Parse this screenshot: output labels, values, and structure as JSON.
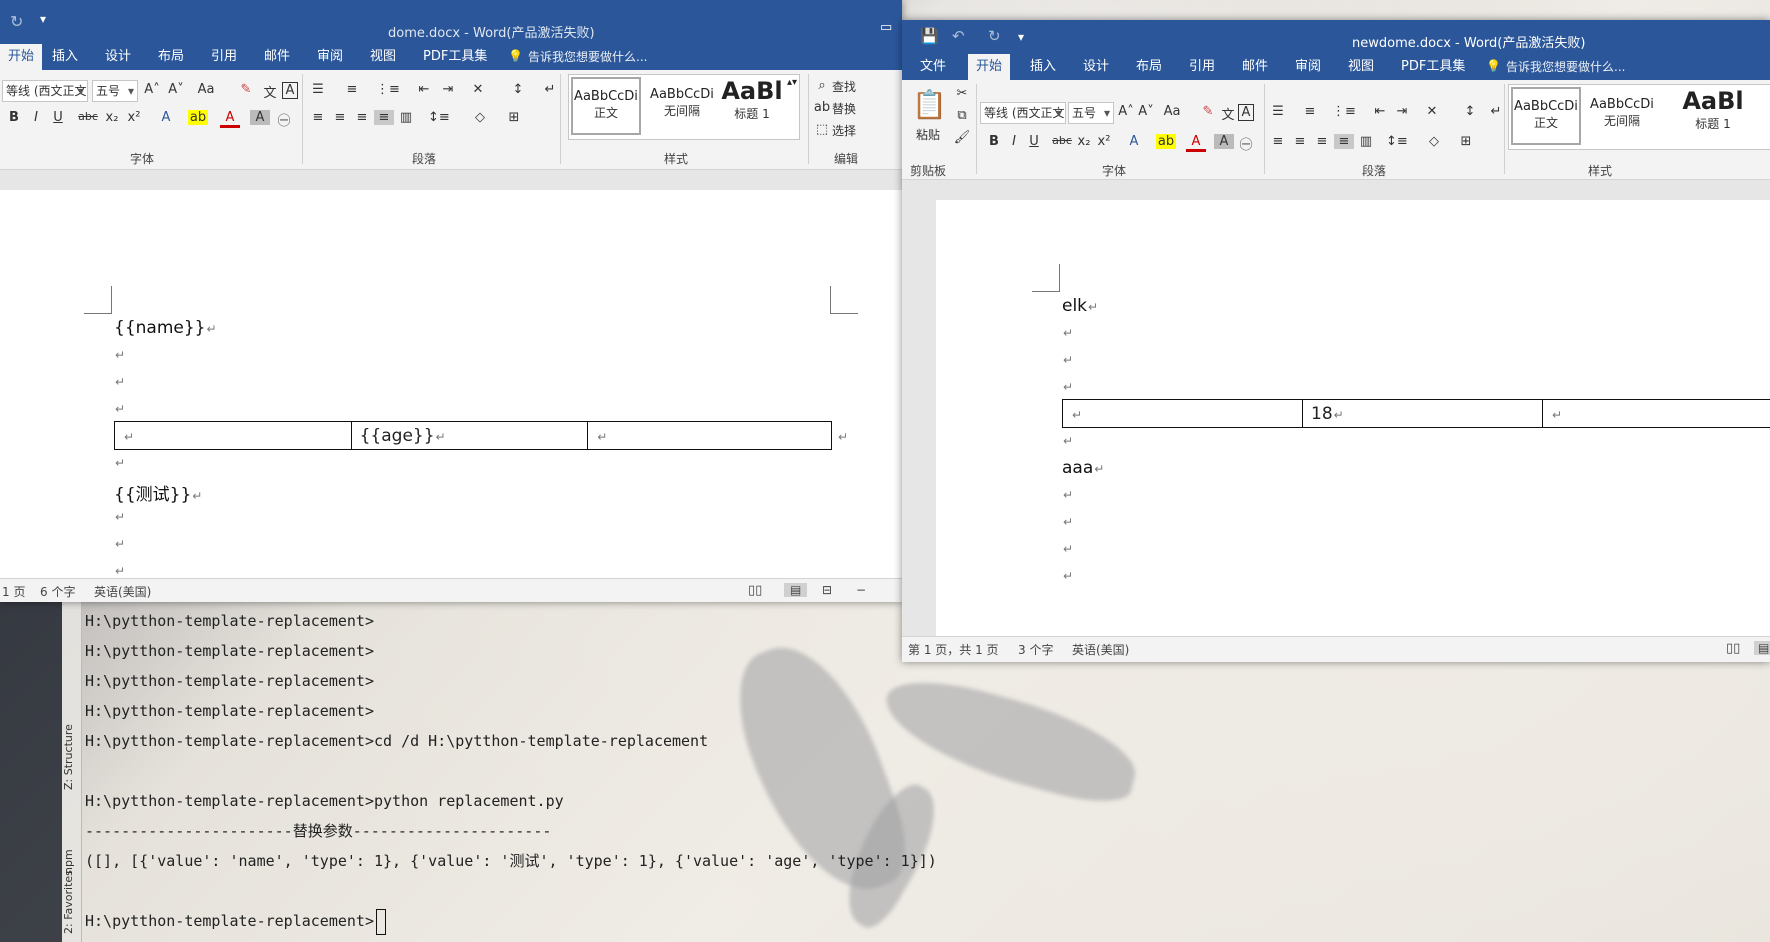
{
  "word_left": {
    "title": "dome.docx - Word(产品激活失败)",
    "tabs": [
      "开始",
      "插入",
      "设计",
      "布局",
      "引用",
      "邮件",
      "审阅",
      "视图",
      "PDF工具集"
    ],
    "tell_me": "告诉我您想要做什么...",
    "font_name": "等线 (西文正文)",
    "font_size": "五号",
    "groups": {
      "font": "字体",
      "paragraph": "段落",
      "styles": "样式",
      "editing": "编辑"
    },
    "styles": [
      {
        "sample": "AaBbCcDi",
        "name": "正文"
      },
      {
        "sample": "AaBbCcDi",
        "name": "无间隔"
      },
      {
        "sample": "AaBl",
        "name": "标题 1"
      }
    ],
    "editing": {
      "find": "查找",
      "replace": "替换",
      "select": "选择"
    },
    "doc": {
      "line1": "{{name}}",
      "cell_age": "{{age}}",
      "line_test": "{{测试}}",
      "pmark": "↵"
    },
    "status": {
      "page": "1 页",
      "words": "6 个字",
      "lang": "英语(美国)"
    }
  },
  "word_right": {
    "title": "newdome.docx - Word(产品激活失败)",
    "tabs": [
      "文件",
      "开始",
      "插入",
      "设计",
      "布局",
      "引用",
      "邮件",
      "审阅",
      "视图",
      "PDF工具集"
    ],
    "tell_me": "告诉我您想要做什么...",
    "paste": "粘贴",
    "clipboard": "剪贴板",
    "font_name": "等线 (西文正文)",
    "font_size": "五号",
    "groups": {
      "font": "字体",
      "paragraph": "段落",
      "styles": "样式"
    },
    "styles": [
      {
        "sample": "AaBbCcDi",
        "name": "正文"
      },
      {
        "sample": "AaBbCcDi",
        "name": "无间隔"
      },
      {
        "sample": "AaBl",
        "name": "标题 1"
      }
    ],
    "doc": {
      "line1": "elk",
      "cell_age": "18",
      "line_test": "aaa",
      "pmark": "↵"
    },
    "status": {
      "page": "第 1 页，共 1 页",
      "words": "3 个字",
      "lang": "英语(美国)"
    }
  },
  "terminal": {
    "lines": [
      "H:\\pytthon-template-replacement>",
      "H:\\pytthon-template-replacement>",
      "H:\\pytthon-template-replacement>",
      "H:\\pytthon-template-replacement>",
      "H:\\pytthon-template-replacement>cd /d H:\\pytthon-template-replacement",
      "",
      "H:\\pytthon-template-replacement>python replacement.py",
      "-----------------------替换参数----------------------",
      "([], [{'value': 'name', 'type': 1}, {'value': '测试', 'type': 1}, {'value': 'age', 'type': 1}])",
      "",
      "H:\\pytthon-template-replacement>"
    ],
    "side_tabs": [
      "Z: Structure",
      "npm",
      "2: Favorites"
    ]
  }
}
